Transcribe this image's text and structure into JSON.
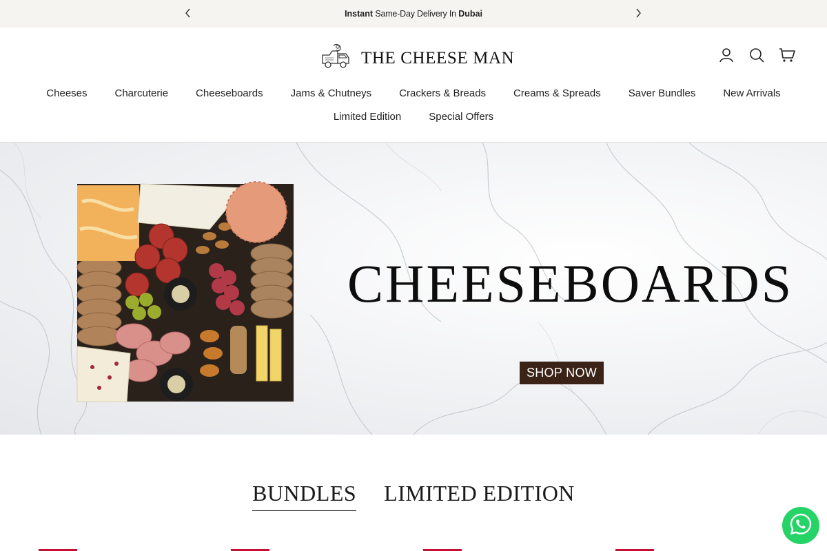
{
  "announcement": {
    "bold_prefix": "Instant",
    "middle": " Same-Day Delivery In ",
    "bold_suffix": "Dubai",
    "prev_icon": "chevron-left-icon",
    "next_icon": "chevron-right-icon"
  },
  "header": {
    "brand": "THE CHEESE MAN",
    "logo_icon": "delivery-truck-logo-icon",
    "icons": [
      "account-icon",
      "search-icon",
      "cart-icon"
    ]
  },
  "nav": {
    "row1": [
      "Cheeses",
      "Charcuterie",
      "Cheeseboards",
      "Jams & Chutneys",
      "Crackers & Breads",
      "Creams & Spreads",
      "Saver Bundles",
      "New Arrivals"
    ],
    "row2": [
      "Limited Edition",
      "Special Offers"
    ]
  },
  "hero": {
    "title": "CHEESEBOARDS",
    "button": "SHOP NOW",
    "button_color": "#3b2417"
  },
  "tabs": {
    "items": [
      "BUNDLES",
      "LIMITED EDITION"
    ],
    "active": "BUNDLES"
  },
  "colors": {
    "announce_bg": "#f5f4f0",
    "badge_red": "#c8102e",
    "whatsapp_green": "#25d366"
  },
  "floating": {
    "whatsapp_icon": "whatsapp-icon"
  }
}
